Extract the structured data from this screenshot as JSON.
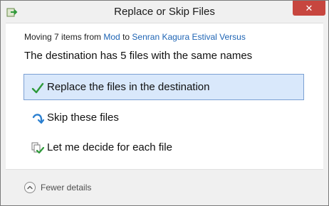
{
  "window": {
    "title": "Replace or Skip Files",
    "close_glyph": "✕"
  },
  "header": {
    "moving_prefix": "Moving 7 items from",
    "source": "Mod",
    "to_word": "to",
    "destination": "Senran Kagura Estival Versus"
  },
  "message": "The destination has 5 files with the same names",
  "options": [
    {
      "label": "Replace the files in the destination",
      "icon": "checkmark-icon",
      "selected": true
    },
    {
      "label": "Skip these files",
      "icon": "skip-arrow-icon",
      "selected": false
    },
    {
      "label": "Let me decide for each file",
      "icon": "decide-files-icon",
      "selected": false
    }
  ],
  "footer": {
    "details_label": "Fewer details",
    "icon": "chevron-up-icon"
  },
  "colors": {
    "accent": "#1e64b4",
    "selected_bg": "#d9e8fb",
    "selected_border": "#7ba0d3",
    "close_red": "#c7463f",
    "check_green": "#2e9a3a"
  }
}
